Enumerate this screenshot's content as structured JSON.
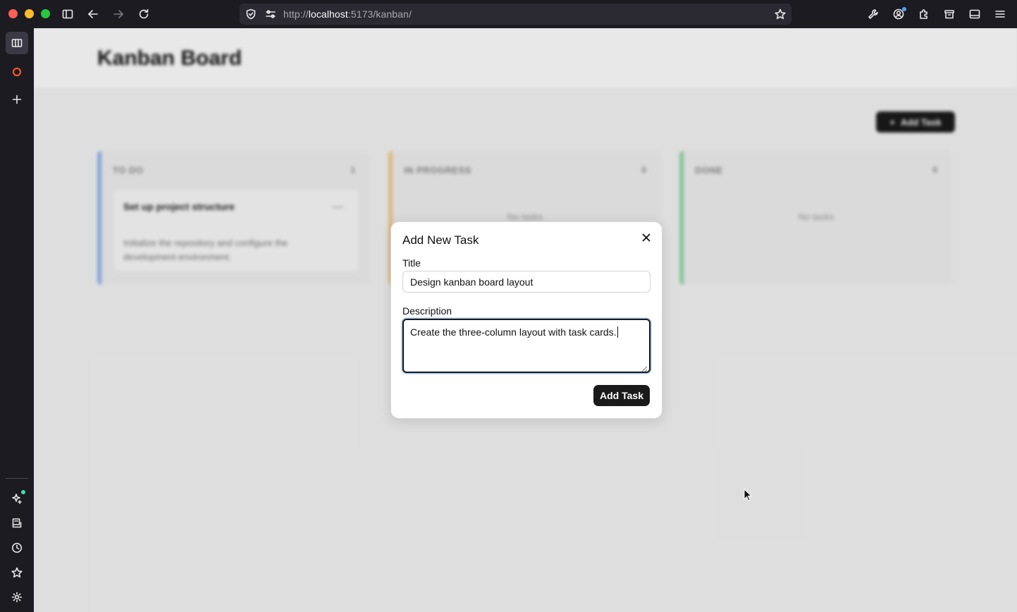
{
  "browser": {
    "url_prefix": "http://",
    "url_host": "localhost",
    "url_path": ":5173/kanban/"
  },
  "page": {
    "title": "Kanban Board",
    "add_task_label": "Add Task",
    "columns": [
      {
        "title": "TO DO",
        "count": "1",
        "color": "#93b4f0"
      },
      {
        "title": "IN PROGRESS",
        "count": "0",
        "color": "#f3c98b",
        "empty": "No tasks"
      },
      {
        "title": "DONE",
        "count": "0",
        "color": "#8fd9a8",
        "empty": "No tasks"
      }
    ],
    "todo_task": {
      "title": "Set up project structure",
      "description": "Initialize the repository and configure the development environment."
    }
  },
  "modal": {
    "title": "Add New Task",
    "title_label": "Title",
    "title_value": "Design kanban board layout",
    "description_label": "Description",
    "description_value": "Create the three-column layout with task cards.",
    "submit_label": "Add Task"
  },
  "colors": {
    "primary_button": "#1a1a1a",
    "todo_accent": "#93b4f0",
    "progress_accent": "#f3c98b",
    "done_accent": "#8fd9a8"
  }
}
